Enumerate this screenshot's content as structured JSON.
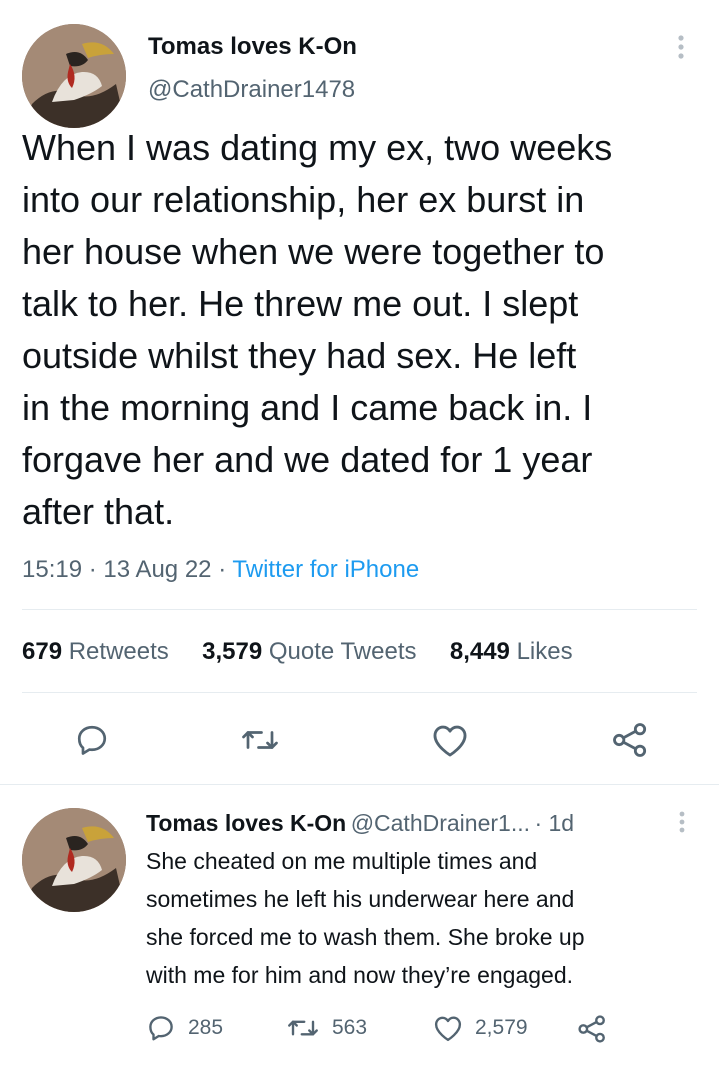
{
  "tweet": {
    "author_name": "Tomas loves K-On",
    "author_handle": "@CathDrainer1478",
    "avatar_icon": "painting-avatar",
    "text_lines": [
      "When I was dating my ex, two weeks",
      "into our relationship, her ex burst in",
      "her house when we were together to",
      "talk to her. He threw me out. I slept",
      "outside whilst they had sex. He left",
      "in the morning and I came back in. I",
      "forgave her and we dated for 1 year",
      "after that."
    ],
    "time": "15:19",
    "date": "13 Aug 22",
    "source": "Twitter for iPhone",
    "stats": {
      "retweets_count": "679",
      "retweets_label": "Retweets",
      "quotes_count": "3,579",
      "quotes_label": "Quote Tweets",
      "likes_count": "8,449",
      "likes_label": "Likes"
    },
    "actions": [
      "reply-icon",
      "retweet-icon",
      "like-icon",
      "share-icon"
    ]
  },
  "reply": {
    "author_name": "Tomas loves K-On",
    "author_handle": "@CathDrainer1...",
    "age": "1d",
    "text_lines": [
      "She cheated on me multiple times and",
      "sometimes he left his underwear here and",
      "she forced me to wash them. She broke up",
      "with me for him and now they’re engaged."
    ],
    "reply_count": "285",
    "retweet_count": "563",
    "like_count": "2,579"
  },
  "colors": {
    "text": "#0f1419",
    "secondary": "#536471",
    "link": "#1d9bf0",
    "icon": "#536471",
    "divider": "#e6ecf0"
  }
}
